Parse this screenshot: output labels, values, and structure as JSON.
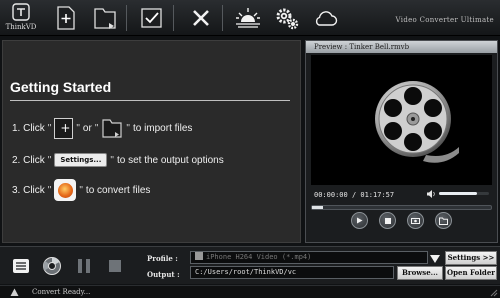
{
  "app": {
    "logo_text": "ThinkVD",
    "title": "Video Converter Ultimate"
  },
  "toolbar": {
    "buttons": [
      {
        "name": "add-file",
        "icon": "add-file-icon"
      },
      {
        "name": "add-folder",
        "icon": "folder-icon"
      },
      {
        "name": "select-all",
        "icon": "checkbox-icon"
      },
      {
        "name": "remove",
        "icon": "close-icon"
      },
      {
        "name": "options",
        "icon": "sunrise-icon"
      },
      {
        "name": "settings",
        "icon": "gears-icon"
      },
      {
        "name": "cloud",
        "icon": "cloud-icon"
      }
    ]
  },
  "getting_started": {
    "title": "Getting Started",
    "step1_prefix": "1. Click",
    "step1_or": "or",
    "step1_suffix": "to import files",
    "step2_prefix": "2. Click",
    "step2_button": "Settings...",
    "step2_suffix": "to set the output options",
    "step3_prefix": "3. Click",
    "step3_suffix": "to convert files",
    "quote": "\""
  },
  "preview": {
    "header": "Preview : Tinker Bell.rmvb",
    "current_time": "00:00:00",
    "separator": "/",
    "total_time": "01:17:57",
    "volume_fraction": 0.75,
    "seek_fraction": 0.06
  },
  "output": {
    "profile_label": "Profile :",
    "profile_value": "iPhone H264 Video (*.mp4)",
    "output_label": "Output :",
    "output_path": "C:/Users/root/ThinkVD/vc",
    "settings_button": "Settings >>",
    "browse_button": "Browse...",
    "open_folder_button": "Open Folder"
  },
  "status": {
    "text": "Convert Ready..."
  },
  "colors": {
    "background": "#101214",
    "panel": "#2a2a2a",
    "convert_accent": "#e66a1a"
  }
}
